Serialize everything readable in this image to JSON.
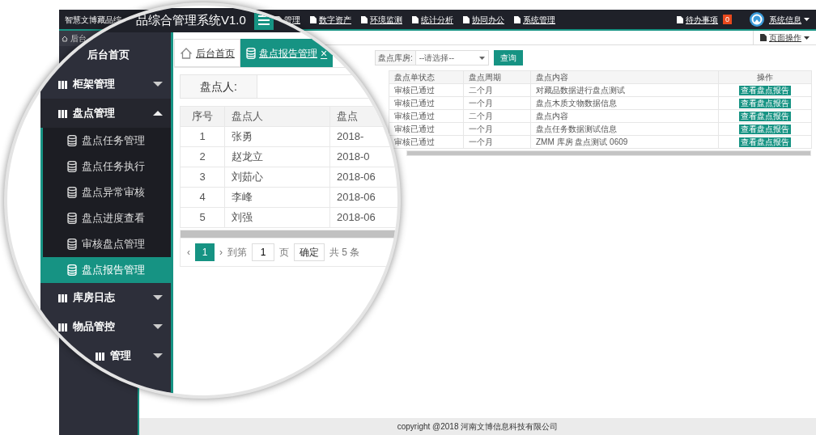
{
  "header": {
    "title": "智慧文博藏品综",
    "nav": [
      {
        "label": "管理"
      },
      {
        "label": "数字资产"
      },
      {
        "label": "环境监测"
      },
      {
        "label": "统计分析"
      },
      {
        "label": "协同办公"
      },
      {
        "label": "系统管理"
      }
    ],
    "todo": {
      "label": "待办事项",
      "count": "0"
    },
    "user": "系统信息"
  },
  "breadcrumb": "后台",
  "toolbar": {
    "page_ops": "页面操作"
  },
  "filter": {
    "label": "盘点库房:",
    "select": "--请选择--",
    "button": "查询"
  },
  "table": {
    "columns": [
      "盘点单状态",
      "盘点周期",
      "盘点内容",
      "操作"
    ],
    "rows": [
      [
        "审核已通过",
        "二个月",
        "对藏品数据进行盘点测试",
        "查看盘点报告"
      ],
      [
        "审核已通过",
        "一个月",
        "盘点木质文物数据信息",
        "查看盘点报告"
      ],
      [
        "审核已通过",
        "二个月",
        "盘点内容",
        "查看盘点报告"
      ],
      [
        "审核已通过",
        "一个月",
        "盘点任务数据测试信息",
        "查看盘点报告"
      ],
      [
        "审核已通过",
        "一个月",
        "ZMM 库房 盘点测试 0609",
        "查看盘点报告"
      ]
    ]
  },
  "footer": "copyright @2018 河南文博信息科技有限公司",
  "magnifier": {
    "title": "品综合管理系统V1.0",
    "sidebar": [
      {
        "kind": "link",
        "label": "后台首页"
      },
      {
        "kind": "menu",
        "label": "柜架管理",
        "expanded": false
      },
      {
        "kind": "menu",
        "label": "盘点管理",
        "expanded": true,
        "children": [
          {
            "label": "盘点任务管理",
            "selected": false
          },
          {
            "label": "盘点任务执行",
            "selected": false
          },
          {
            "label": "盘点异常审核",
            "selected": false
          },
          {
            "label": "盘点进度查看",
            "selected": false
          },
          {
            "label": "审核盘点管理",
            "selected": false
          },
          {
            "label": "盘点报告管理",
            "selected": true
          }
        ]
      },
      {
        "kind": "menu",
        "label": "库房日志",
        "expanded": false
      },
      {
        "kind": "menu",
        "label": "物品管控",
        "expanded": false
      },
      {
        "kind": "menu",
        "label": "管理",
        "expanded": false
      }
    ],
    "tabs": [
      {
        "label": "后台首页",
        "selected": false
      },
      {
        "label": "盘点报告管理",
        "selected": true,
        "close": "×"
      }
    ],
    "search": {
      "label": "盘点人:"
    },
    "table": {
      "columns": [
        "序号",
        "盘点人",
        "盘点"
      ],
      "rows": [
        [
          "1",
          "张勇",
          "2018-"
        ],
        [
          "2",
          "赵龙立",
          "2018-0"
        ],
        [
          "3",
          "刘茹心",
          "2018-06"
        ],
        [
          "4",
          "李峰",
          "2018-06"
        ],
        [
          "5",
          "刘强",
          "2018-06"
        ]
      ]
    },
    "pagination": {
      "prev": "‹",
      "page": "1",
      "next": "›",
      "goto": "到第",
      "input": "1",
      "unit": "页",
      "ok": "确定",
      "total": "共 5 条"
    }
  }
}
